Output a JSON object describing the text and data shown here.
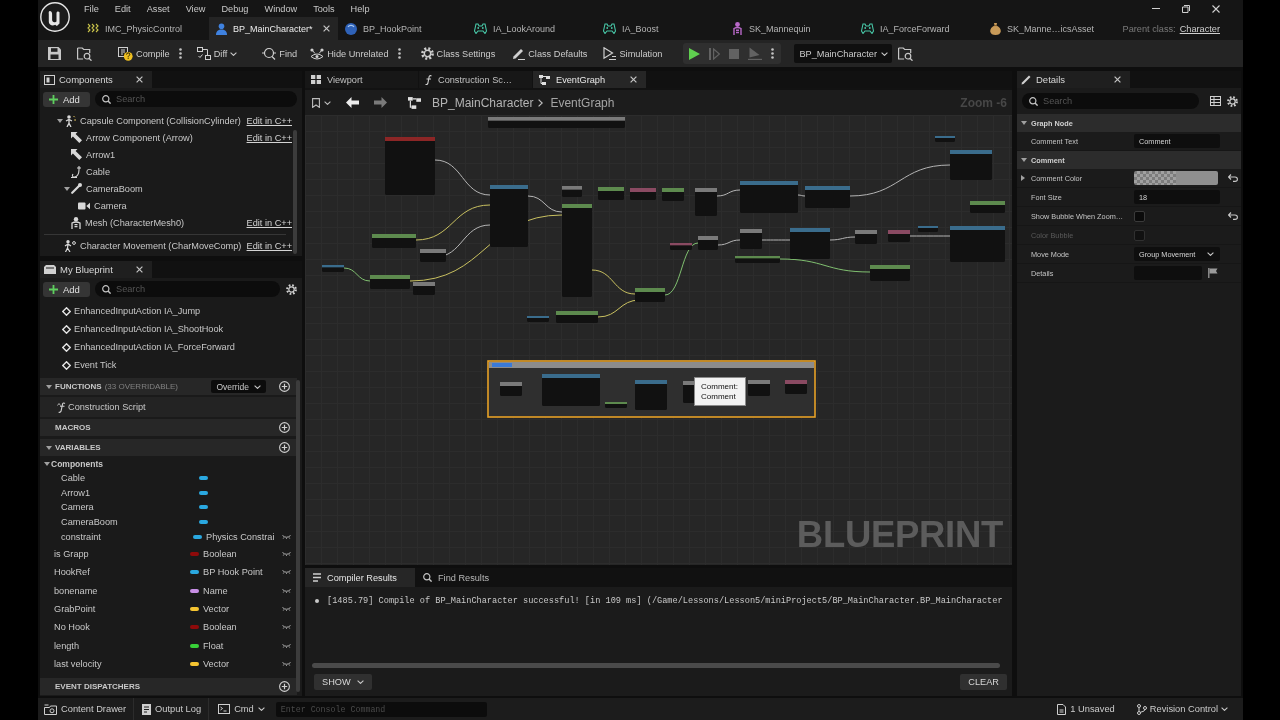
{
  "menu": [
    "File",
    "Edit",
    "Asset",
    "View",
    "Debug",
    "Window",
    "Tools",
    "Help"
  ],
  "asset_tabs": [
    {
      "label": "IMC_PhysicControl",
      "kind": "input_mapping",
      "selected": false
    },
    {
      "label": "BP_MainCharacter*",
      "kind": "character_blueprint",
      "selected": true
    },
    {
      "label": "BP_HookPoint",
      "kind": "actor_blueprint",
      "selected": false
    },
    {
      "label": "IA_LookAround",
      "kind": "input_action",
      "selected": false
    },
    {
      "label": "IA_Boost",
      "kind": "input_action",
      "selected": false
    },
    {
      "label": "SK_Mannequin",
      "kind": "skeleton",
      "selected": false
    },
    {
      "label": "IA_ForceForward",
      "kind": "input_action",
      "selected": false
    },
    {
      "label": "SK_Manne…icsAsset",
      "kind": "physics_asset",
      "selected": false
    }
  ],
  "parent_class": {
    "label": "Parent class:",
    "value": "Character"
  },
  "toolbar": {
    "items": [
      {
        "label": "Compile",
        "kind": "compile",
        "up_to_date": false,
        "dropdown": false
      },
      {
        "kind": "more_options"
      },
      {
        "label": "Diff",
        "kind": "diff",
        "dropdown": true
      },
      {
        "label": "Find",
        "kind": "find",
        "dropdown": false
      },
      {
        "label": "Hide Unrelated",
        "kind": "hide_unrelated",
        "dropdown": false
      },
      {
        "kind": "more_options"
      },
      {
        "label": "Class Settings",
        "kind": "class_settings",
        "dropdown": false
      },
      {
        "label": "Class Defaults",
        "kind": "class_defaults",
        "dropdown": false
      },
      {
        "label": "Simulation",
        "kind": "simulation",
        "dropdown": false
      }
    ],
    "play_controls": [
      {
        "kind": "play",
        "disabled": false
      },
      {
        "kind": "advance",
        "disabled": true
      },
      {
        "kind": "stop",
        "disabled": true
      },
      {
        "kind": "eject",
        "disabled": true
      }
    ],
    "debug_object": "BP_MainCharacter"
  },
  "components": {
    "title": "Components",
    "add": "Add",
    "search_placeholder": "Search",
    "tree": [
      {
        "label": "Capsule Component (CollisionCylinder)",
        "kind": "capsule",
        "expanded": true,
        "action": "Edit in C++",
        "children": [
          {
            "label": "Arrow Component (Arrow)",
            "kind": "arrow",
            "action": "Edit in C++"
          },
          {
            "label": "Arrow1",
            "kind": "arrow"
          },
          {
            "label": "Cable",
            "kind": "cable"
          },
          {
            "label": "CameraBoom",
            "kind": "spring_arm",
            "expanded": true,
            "children": [
              {
                "label": "Camera",
                "kind": "camera"
              }
            ]
          },
          {
            "label": "Mesh (CharacterMesh0)",
            "kind": "mesh",
            "action": "Edit in C++"
          }
        ]
      }
    ],
    "extra": [
      {
        "label": "Character Movement (CharMoveComp)",
        "kind": "movement",
        "action": "Edit in C++"
      }
    ]
  },
  "my_blueprint": {
    "title": "My Blueprint",
    "add": "Add",
    "search_placeholder": "Search",
    "graph_items": [
      {
        "label": "EnhancedInputAction IA_Jump",
        "kind": "event"
      },
      {
        "label": "EnhancedInputAction IA_ShootHook",
        "kind": "event"
      },
      {
        "label": "EnhancedInputAction IA_ForceForward",
        "kind": "event"
      },
      {
        "label": "Event Tick",
        "kind": "event"
      }
    ],
    "functions": {
      "title": "FUNCTIONS",
      "note": "(33 OVERRIDABLE)",
      "override": "Override",
      "expanded": true,
      "items": [
        {
          "label": "Construction Script",
          "kind": "construction_script"
        }
      ]
    },
    "macros": {
      "title": "MACROS"
    },
    "variables": {
      "title": "VARIABLES",
      "expanded": true,
      "categories": [
        {
          "label": "Components",
          "expanded": true,
          "items": [
            {
              "name": "Cable",
              "color": "#2aa8e0"
            },
            {
              "name": "Arrow1",
              "color": "#2aa8e0"
            },
            {
              "name": "Camera",
              "color": "#2aa8e0"
            },
            {
              "name": "CameraBoom",
              "color": "#2aa8e0"
            },
            {
              "name": "constraint",
              "type": "Physics Constrai",
              "color": "#2aa8e0",
              "instance_editable": false
            }
          ]
        }
      ],
      "items": [
        {
          "name": "is Grapp",
          "type": "Boolean",
          "color": "#8e0a0a",
          "instance_editable": false
        },
        {
          "name": "HookRef",
          "type": "BP Hook Point",
          "color": "#2aa8e0",
          "instance_editable": false
        },
        {
          "name": "bonename",
          "type": "Name",
          "color": "#c88fe6",
          "instance_editable": false
        },
        {
          "name": "GrabPoint",
          "type": "Vector",
          "color": "#f5c431",
          "instance_editable": false
        },
        {
          "name": "No Hook",
          "type": "Boolean",
          "color": "#8e0a0a",
          "instance_editable": false
        },
        {
          "name": "length",
          "type": "Float",
          "color": "#38d038",
          "instance_editable": false
        },
        {
          "name": "last velocity",
          "type": "Vector",
          "color": "#f5c431",
          "instance_editable": false
        }
      ]
    },
    "event_dispatchers": {
      "title": "EVENT DISPATCHERS"
    }
  },
  "graph_editor": {
    "tabs": [
      {
        "label": "Viewport",
        "kind": "viewport",
        "selected": false
      },
      {
        "label": "Construction Sc…",
        "kind": "function",
        "selected": false
      },
      {
        "label": "EventGraph",
        "kind": "graph",
        "selected": true
      }
    ],
    "breadcrumb": [
      "BP_MainCharacter",
      "EventGraph"
    ],
    "zoom": "Zoom -6",
    "tooltip": {
      "title": "Comment:",
      "text": "Comment"
    },
    "graph_label": "BLUEPRINT"
  },
  "compiler": {
    "tabs": [
      {
        "label": "Compiler Results",
        "kind": "results",
        "selected": true
      },
      {
        "label": "Find Results",
        "kind": "find",
        "selected": false
      }
    ],
    "messages": [
      "[1485.79] Compile of BP_MainCharacter successful! [in 109 ms] (/Game/Lessons/Lesson5/miniProject5/BP_MainCharacter.BP_MainCharacter"
    ],
    "show": "SHOW",
    "clear": "CLEAR"
  },
  "details": {
    "title": "Details",
    "search_placeholder": "Search",
    "categories": [
      {
        "title": "Graph Node",
        "expanded": true,
        "properties": [
          {
            "label": "Comment Text",
            "kind": "text",
            "value": "Comment",
            "reset": false
          }
        ]
      },
      {
        "title": "Comment",
        "expanded": true,
        "properties": [
          {
            "label": "Comment Color",
            "kind": "color",
            "expanded": false,
            "reset": true
          },
          {
            "label": "Font Size",
            "kind": "number",
            "value": "18",
            "reset": false
          },
          {
            "label": "Show Bubble When Zoom…",
            "kind": "checkbox",
            "checked": false,
            "disabled": false,
            "reset": true
          },
          {
            "label": "Color Bubble",
            "kind": "checkbox",
            "checked": false,
            "disabled": true,
            "reset": false
          },
          {
            "label": "Move Mode",
            "kind": "dropdown",
            "value": "Group Movement",
            "reset": false
          },
          {
            "label": "Details",
            "kind": "text_flag",
            "reset": false
          }
        ]
      }
    ]
  },
  "status_bar": {
    "items": [
      {
        "label": "Content Drawer",
        "kind": "content_drawer",
        "dropdown": false
      },
      {
        "label": "Output Log",
        "kind": "output_log",
        "dropdown": false
      },
      {
        "label": "Cmd",
        "kind": "cmd",
        "dropdown": true
      }
    ],
    "console_placeholder": "Enter Console Command",
    "unsaved": "1 Unsaved",
    "revision_control": "Revision Control"
  }
}
